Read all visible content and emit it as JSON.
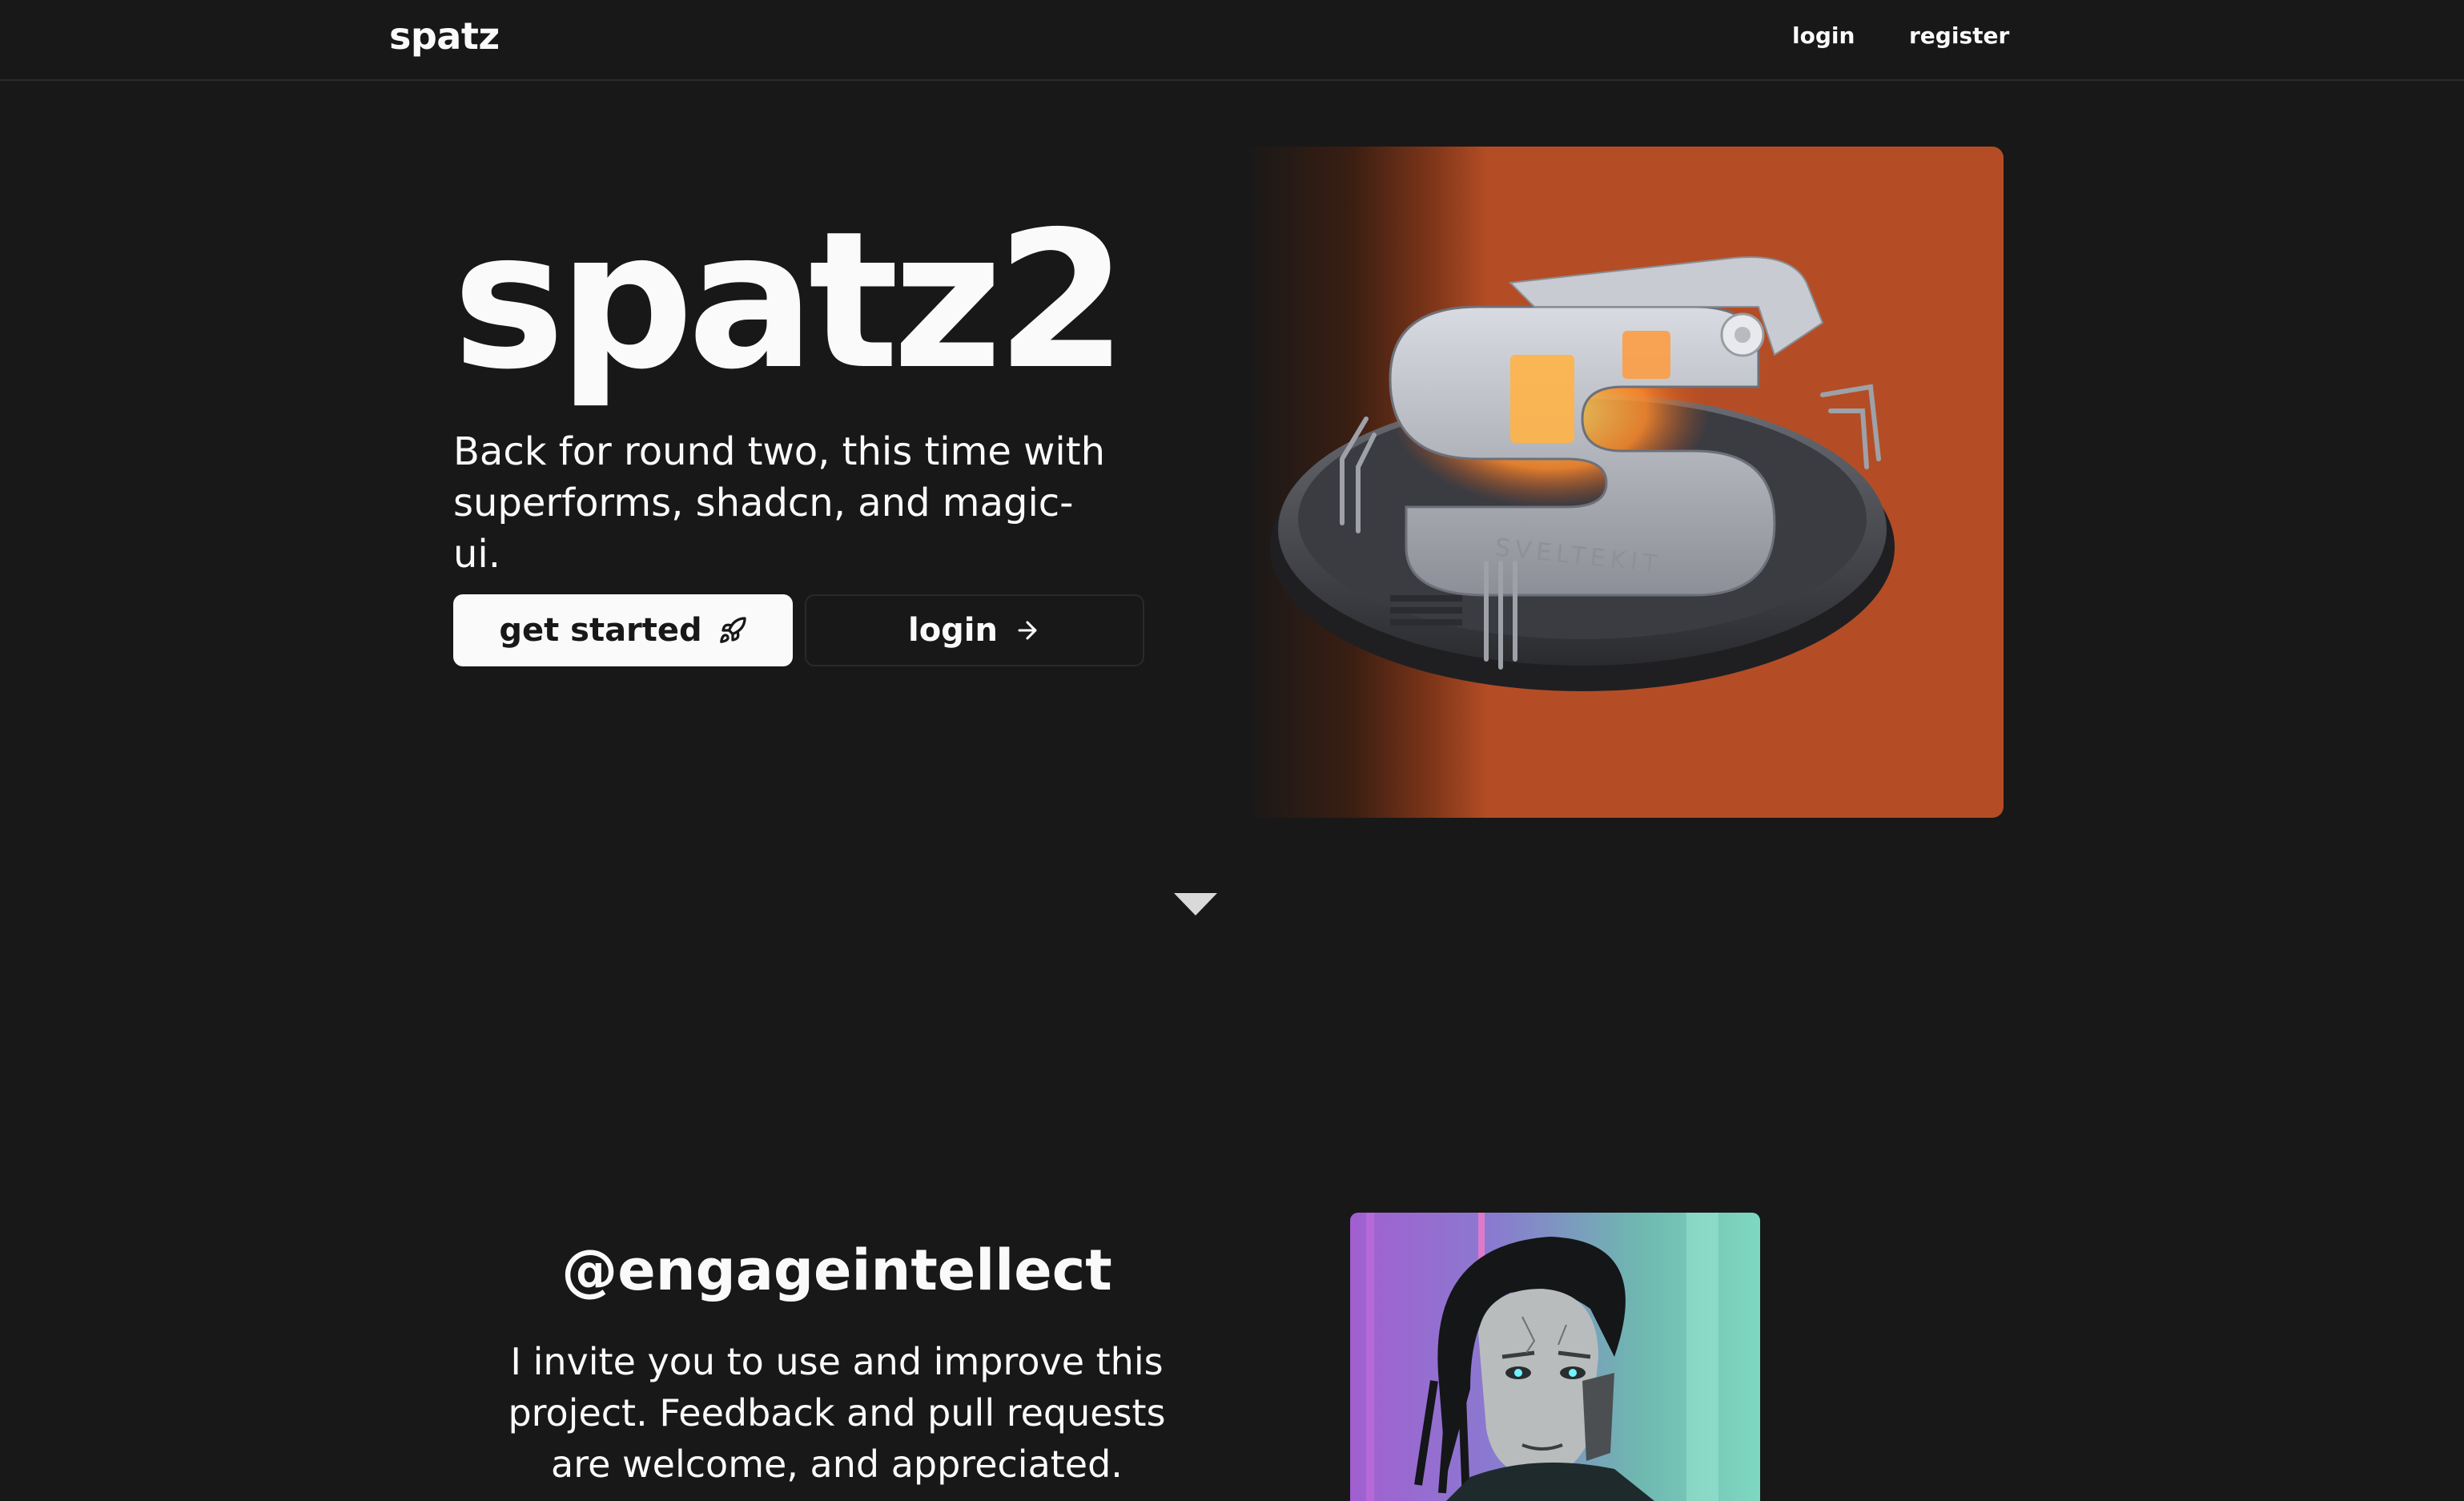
{
  "nav": {
    "brand": "spatz",
    "login": "login",
    "register": "register"
  },
  "hero": {
    "title": "spatz2",
    "tagline": "Back for round two, this time with superforms, shadcn, and magic-ui.",
    "primary_button": {
      "label": "get started",
      "icon": "rocket-icon"
    },
    "secondary_button": {
      "label": "login",
      "icon": "arrow-right-icon"
    },
    "image": {
      "subject": "3D metallic S logo on orange background",
      "engraved_text": "SVELTEKIT"
    }
  },
  "scroll_indicator": {
    "icon": "chevron-down-icon"
  },
  "author": {
    "handle": "@engageintellect",
    "blurb": "I invite you to use and improve this project. Feedback and pull requests are welcome, and appreciated.",
    "avatar": {
      "subject": "cyberpunk portrait"
    }
  },
  "colors": {
    "background": "#181818",
    "foreground": "#fafafa",
    "accent_orange": "#b44d25",
    "border": "#2c2c2c"
  }
}
